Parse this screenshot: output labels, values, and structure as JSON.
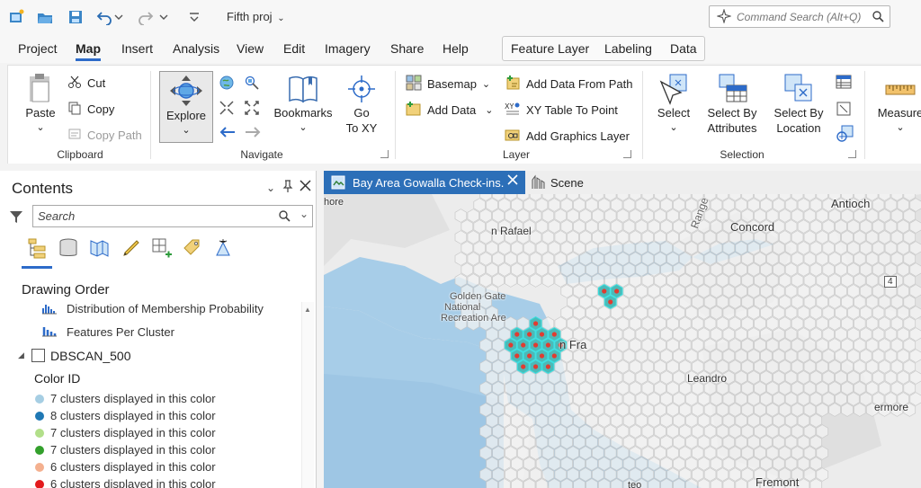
{
  "quick_access": {
    "project_name": "Fifth proj",
    "command_search_placeholder": "Command Search (Alt+Q)"
  },
  "menu": {
    "tabs": [
      "Project",
      "Map",
      "Insert",
      "Analysis",
      "View",
      "Edit",
      "Imagery",
      "Share",
      "Help"
    ],
    "active": "Map",
    "contextual_tabs": [
      "Feature Layer",
      "Labeling",
      "Data"
    ]
  },
  "ribbon": {
    "clipboard": {
      "label": "Clipboard",
      "paste": "Paste",
      "cut": "Cut",
      "copy": "Copy",
      "copy_path": "Copy Path"
    },
    "navigate": {
      "label": "Navigate",
      "explore": "Explore",
      "bookmarks": "Bookmarks",
      "go_to_xy_line1": "Go",
      "go_to_xy_line2": "To XY"
    },
    "layer": {
      "label": "Layer",
      "basemap": "Basemap",
      "add_data": "Add Data",
      "add_data_from_path": "Add Data From Path",
      "xy_table_to_point": "XY Table To Point",
      "add_graphics_layer": "Add Graphics Layer"
    },
    "selection": {
      "label": "Selection",
      "select": "Select",
      "select_by_attributes_line1": "Select By",
      "select_by_attributes_line2": "Attributes",
      "select_by_location_line1": "Select By",
      "select_by_location_line2": "Location"
    },
    "inquiry": {
      "measure": "Measure"
    }
  },
  "contents": {
    "title": "Contents",
    "search_placeholder": "Search",
    "drawing_order": "Drawing Order",
    "chart_items": [
      "Distribution of Membership Probability",
      "Features Per Cluster"
    ],
    "layer_name": "DBSCAN_500",
    "field_name": "Color ID",
    "legend": [
      {
        "label": "7 clusters displayed in this color",
        "color": "#a6cee3"
      },
      {
        "label": "8 clusters displayed in this color",
        "color": "#1f78b4"
      },
      {
        "label": "7 clusters displayed in this color",
        "color": "#b2df8a"
      },
      {
        "label": "7 clusters displayed in this color",
        "color": "#33a02c"
      },
      {
        "label": "6 clusters displayed in this color",
        "color": "#f4b08f"
      },
      {
        "label": "6 clusters displayed in this color",
        "color": "#e31a1c"
      }
    ]
  },
  "map_view": {
    "tabs": [
      "Bay Area Gowalla Check-ins.",
      "Scene"
    ],
    "labels": {
      "antioch": "Antioch",
      "rafael": "n Rafael",
      "concord": "Concord",
      "range": "Range",
      "golden_gate_1": "Golden Gate",
      "golden_gate_2": "National",
      "golden_gate_3": "Recreation Are",
      "fran": "n Fra",
      "leandro": "Leandro",
      "more": "ermore",
      "fremont": "Fremont",
      "shield": "4",
      "hore": "hore",
      "teo": "teo"
    },
    "colors": {
      "water": "#a7cde8",
      "land": "#ececec",
      "hex_empty": "#f3f3f3",
      "hex_cluster": "#4bbab8",
      "cluster_dot": "#e03c31",
      "active_tab": "#2c6fb8"
    }
  }
}
